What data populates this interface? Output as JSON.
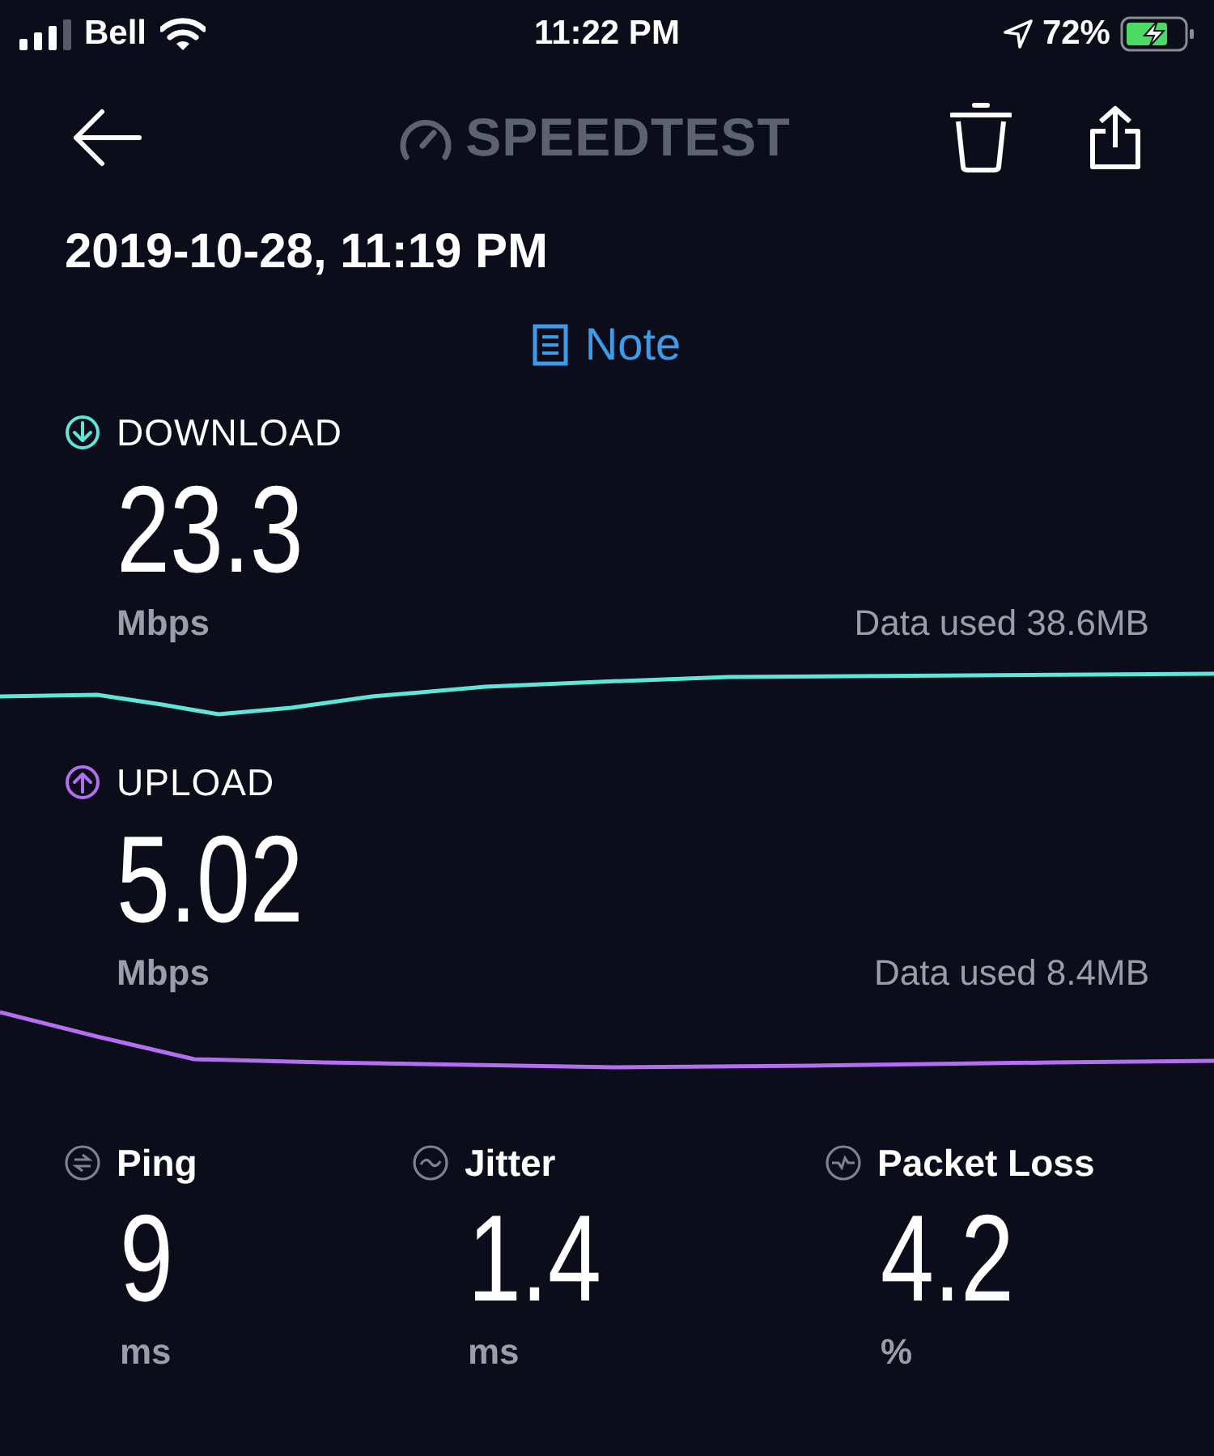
{
  "status_bar": {
    "carrier": "Bell",
    "time": "11:22 PM",
    "battery": "72%"
  },
  "header": {
    "logo": "SPEEDTEST"
  },
  "date": "2019-10-28, 11:19 PM",
  "note": {
    "label": "Note"
  },
  "results": [
    {
      "label": "DOWNLOAD",
      "kind": "download",
      "color": "#5ee6d8",
      "value": "23.3",
      "unit": "Mbps",
      "data_used": "Data used 38.6MB"
    },
    {
      "label": "UPLOAD",
      "kind": "upload",
      "color": "#b46ff0",
      "value": "5.02",
      "unit": "Mbps",
      "data_used": "Data used 8.4MB"
    }
  ],
  "metrics": [
    {
      "kind": "ping",
      "label": "Ping",
      "value": "9",
      "unit": "ms"
    },
    {
      "kind": "jitter",
      "label": "Jitter",
      "value": "1.4",
      "unit": "ms"
    },
    {
      "kind": "loss",
      "label": "Packet Loss",
      "value": "4.2",
      "unit": "%"
    }
  ]
}
